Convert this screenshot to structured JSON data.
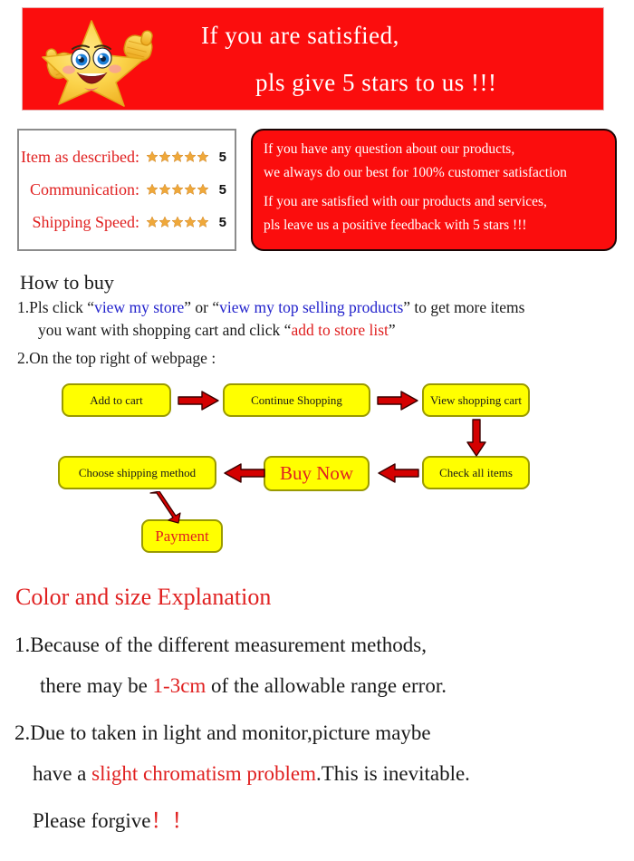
{
  "banner": {
    "line1": "If you are satisfied,",
    "line2": "pls give 5 stars to us !!!",
    "mascot_icon": "smiling-star-thumbs-up-icon",
    "background_color": "#fb0d0d",
    "text_color": "#ffffff"
  },
  "ratings": {
    "rows": [
      {
        "label": "Item as described:",
        "stars": 5,
        "value": "5"
      },
      {
        "label": "Communication:",
        "stars": 5,
        "value": "5"
      },
      {
        "label": "Shipping Speed:",
        "stars": 5,
        "value": "5"
      }
    ],
    "label_color": "#e02020",
    "star_color": "#f0a93c"
  },
  "note": {
    "line1": "If you have any question about our products,",
    "line2": "we always do our best for 100% customer satisfaction",
    "line3": "If you are satisfied with our products and services,",
    "line4": "pls leave us a positive feedback with 5 stars !!!",
    "background_color": "#fb0d0d",
    "text_color": "#ffffff"
  },
  "howto": {
    "title": "How to buy",
    "item1": {
      "prefix": "1.Pls click “",
      "link1": "view my store",
      "mid1": "” or “",
      "link2": "view my top selling products",
      "mid2": "” to get more items",
      "line2_prefix": "you want with shopping cart and click “",
      "link3": "add to store list",
      "line2_suffix": "”"
    },
    "item2": "2.On the top right of webpage :",
    "link_color": "#2222cc",
    "highlight_color": "#e02020"
  },
  "flowchart": {
    "boxes": [
      {
        "label": "Add to cart"
      },
      {
        "label": "Continue Shopping"
      },
      {
        "label": "View shopping cart"
      },
      {
        "label": "Check all items"
      },
      {
        "label": "Buy Now"
      },
      {
        "label": "Choose shipping method"
      },
      {
        "label": "Payment"
      }
    ],
    "box_color": "#ffff00",
    "arrow_color": "#d40000"
  },
  "explanation": {
    "title": "Color and size Explanation",
    "item1_line1": "1.Because of the different measurement methods,",
    "item1_line2_prefix": "there may be ",
    "item1_highlight": "1-3cm",
    "item1_line2_suffix": " of the allowable range error.",
    "item2_line1": "2.Due to taken in light and monitor,picture maybe",
    "item2_line2_prefix": "have a ",
    "item2_highlight": "slight chromatism problem",
    "item2_line2_suffix": ".This is inevitable.",
    "item2_line3": "Please forgive",
    "item2_bangs": "！！",
    "title_color": "#e02020",
    "highlight_color": "#e02020"
  }
}
